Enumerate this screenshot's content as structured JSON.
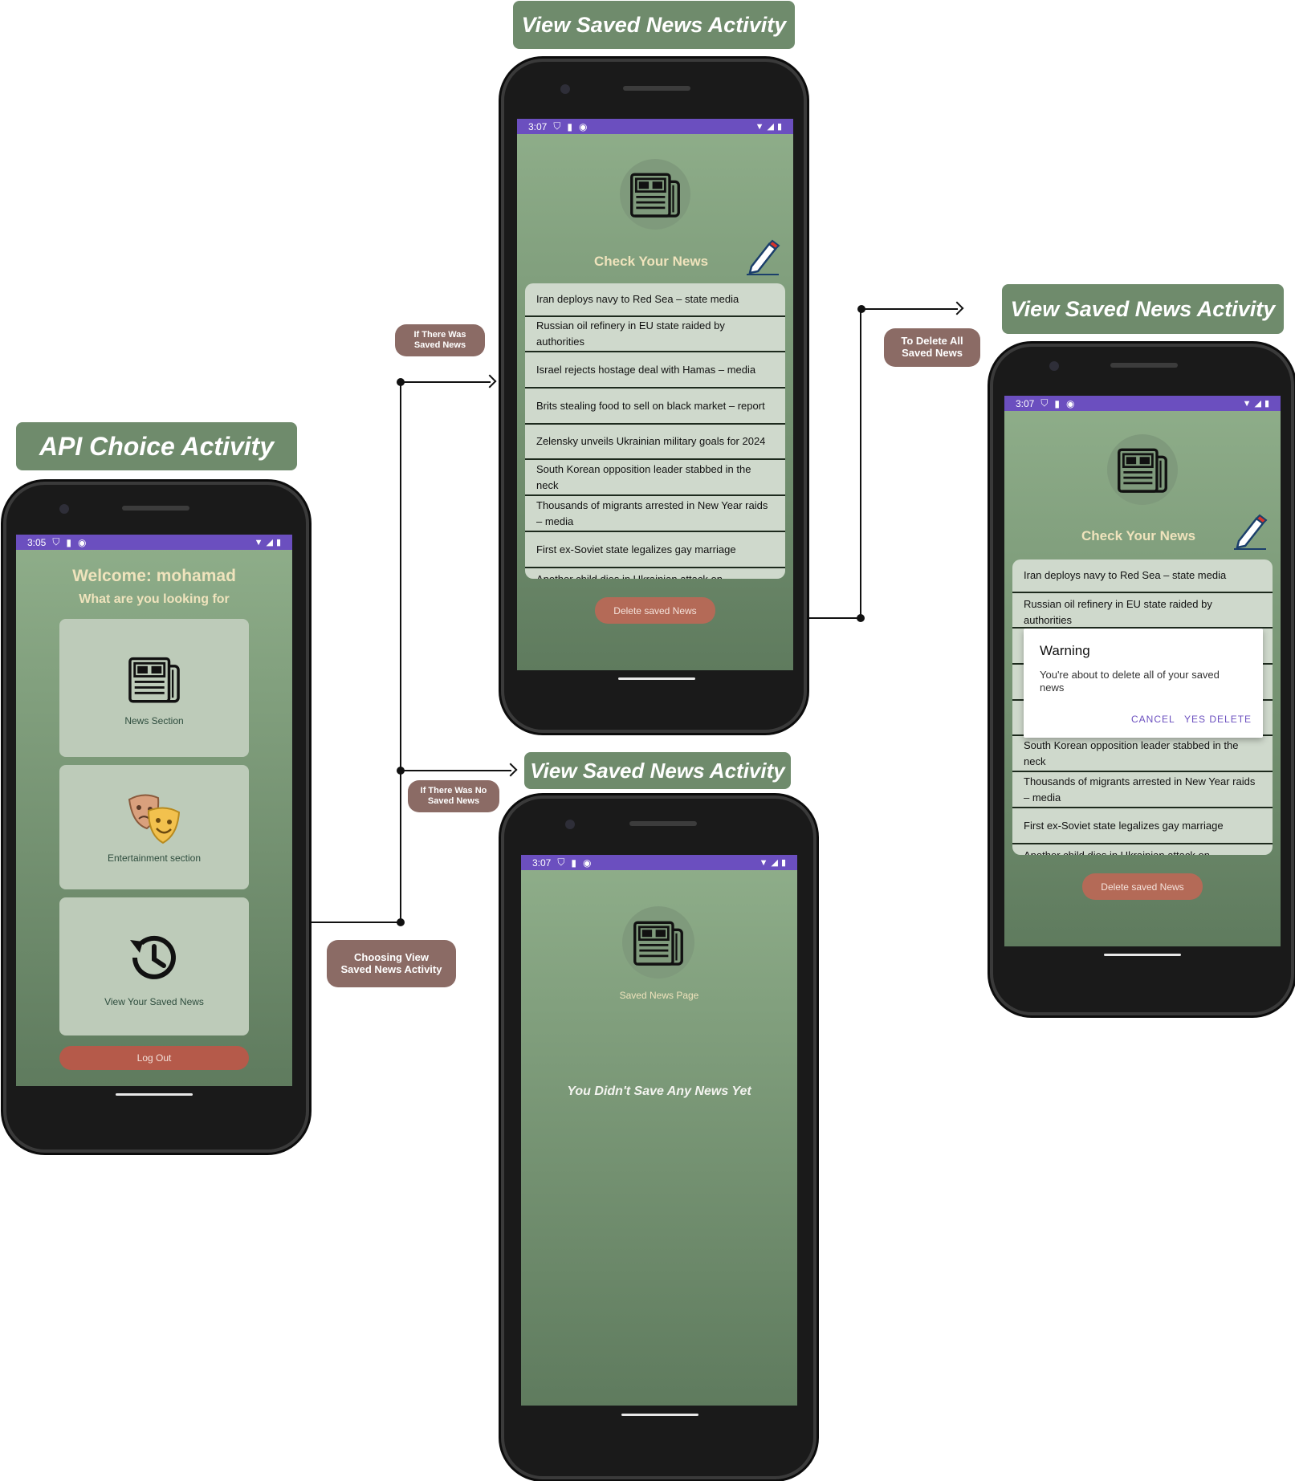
{
  "labels": {
    "api_choice": "API Choice Activity",
    "view_saved_1": "View Saved News Activity",
    "view_saved_2": "View Saved News Activity",
    "view_saved_3": "View Saved News Activity"
  },
  "flow": {
    "if_saved": "If There Was Saved News",
    "if_no_saved": "If There Was  No Saved News",
    "choosing": "Choosing View Saved News Activity",
    "to_delete": "To Delete All Saved News"
  },
  "status": {
    "time_a": "3:05",
    "time_b": "3:07"
  },
  "api_screen": {
    "welcome": "Welcome: mohamad",
    "subtitle": "What are you looking for",
    "card_news": "News Section",
    "card_entertainment": "Entertainment section",
    "card_saved": "View Your Saved News",
    "logout": "Log Out"
  },
  "saved_screen": {
    "title": "Check Your News",
    "delete_button": "Delete saved News",
    "items": [
      "Iran deploys navy to Red Sea – state media",
      "Russian oil refinery in EU state raided by authorities",
      "Israel rejects hostage deal with Hamas – media",
      "Brits stealing food to sell on black market – report",
      "Zelensky unveils Ukrainian military goals for 2024",
      "South Korean opposition leader stabbed in the neck",
      "Thousands of migrants arrested in New Year raids – media",
      "First ex-Soviet state legalizes gay marriage",
      "Another child dies in Ukrainian attack on"
    ]
  },
  "empty_screen": {
    "title": "Saved News Page",
    "message": "You Didn't Save Any News Yet"
  },
  "dialog": {
    "title": "Warning",
    "message": "You're about to delete all of your saved news",
    "cancel": "CANCEL",
    "confirm": "YES DELETE",
    "visible_items_top": [
      "Iran deploys navy to Red Sea – state media",
      "Russian oil refinery in EU state raided by authorities"
    ],
    "visible_items_bottom": [
      "South Korean opposition leader stabbed in the neck",
      "Thousands of migrants arrested in New Year raids – media",
      "First ex-Soviet state legalizes gay marriage",
      "Another child dies in Ukrainian attack on"
    ]
  },
  "colors": {
    "title_label_bg": "#6f8b6c",
    "flow_label_bg": "#8b6b65",
    "status_bar": "#6b4fbf",
    "logout": "#b55a4a",
    "delete": "#b46a57",
    "accent_text": "#efe3bc",
    "dialog_button": "#6b4fbf"
  },
  "icons": [
    "newspaper-icon",
    "theater-masks-icon",
    "history-icon",
    "pencil-icon",
    "shield-icon",
    "sd-card-icon",
    "wifi-icon",
    "signal-icon",
    "battery-icon"
  ]
}
